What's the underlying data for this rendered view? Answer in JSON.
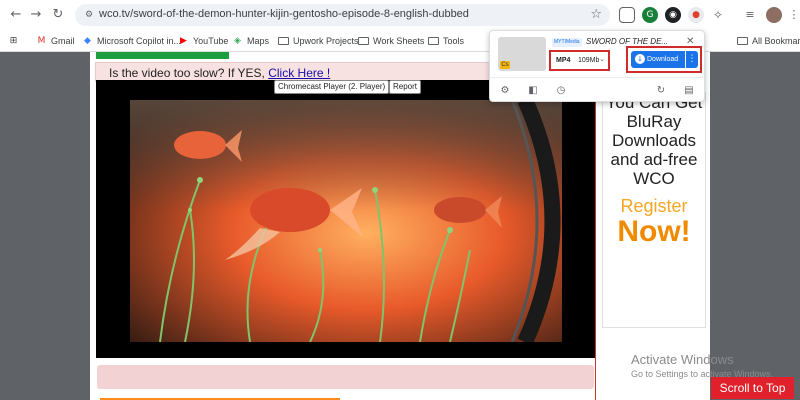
{
  "browser": {
    "url": "wco.tv/sword-of-the-demon-hunter-kijin-gentosho-episode-8-english-dubbed",
    "nav": {
      "back_icon": "←",
      "forward_icon": "→",
      "reload_icon": "↻"
    },
    "bookmarks": [
      {
        "label": "Gmail",
        "icon": "gmail-icon",
        "color": "#d93025"
      },
      {
        "label": "Microsoft Copilot in...",
        "icon": "copilot-icon",
        "color": "#3a86ff"
      },
      {
        "label": "YouTube",
        "icon": "youtube-icon",
        "color": "#ff0000"
      },
      {
        "label": "Maps",
        "icon": "maps-icon",
        "color": "#34a853"
      },
      {
        "label": "Upwork Projects",
        "icon": "folder-icon"
      },
      {
        "label": "Work Sheets",
        "icon": "folder-icon"
      },
      {
        "label": "Tools",
        "icon": "folder-icon"
      }
    ],
    "all_bookmarks": "All Bookmarks"
  },
  "page": {
    "slow_prompt": "Is the video too slow? If YES, ",
    "slow_link": "Click Here !",
    "player_buttons": [
      "Chromecast Player (2. Player)",
      "Report"
    ],
    "ad_lines": "You Can Get BluRay Downloads and ad-free WCO",
    "ad_register": "Register",
    "ad_now": "Now!",
    "scroll_top": "Scroll to Top",
    "colors": {
      "accent_red": "#e0202a",
      "ad_orange": "#f08a00",
      "green": "#1e9e3e"
    }
  },
  "windows": {
    "activate_title": "Activate Windows",
    "activate_sub": "Go to Settings to activate Windows."
  },
  "extension": {
    "source_badge": "MYTIMedia",
    "title": "SWORD OF THE DE...",
    "format": "MP4",
    "size": "109Mb",
    "download_label": "Download",
    "more_label": "⋮",
    "close": "✕",
    "thumb_badge": "Cs",
    "brand_color": "#1a73e8"
  }
}
